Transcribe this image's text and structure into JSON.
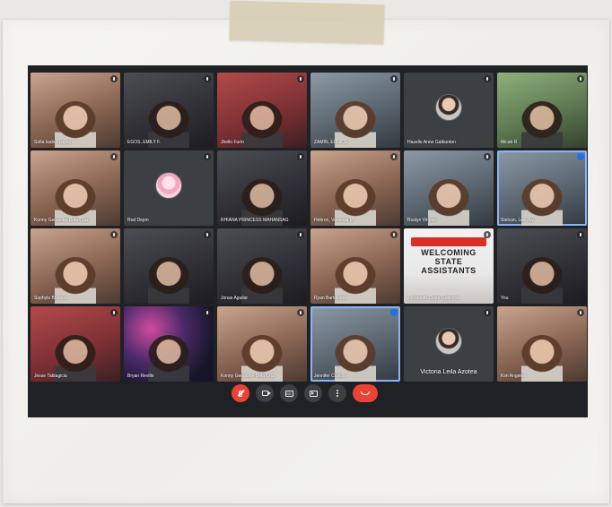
{
  "meeting": {
    "rows": [
      [
        {
          "name": "Sofia Isabel Lopez",
          "type": "video",
          "tone": "warm"
        },
        {
          "name": "EGOS, EMILY F.",
          "type": "video",
          "tone": "dark"
        },
        {
          "name": "Jhello Furio",
          "type": "video",
          "tone": "red"
        },
        {
          "name": "ZAMIN, EUNICE",
          "type": "video",
          "tone": "cool"
        },
        {
          "name": "Hazelle Anne Galbunton",
          "type": "avatar",
          "avatar": "gray"
        },
        {
          "name": "Micah R",
          "type": "video",
          "tone": "green"
        }
      ],
      [
        {
          "name": "Konny Geraldine Dela Cruz",
          "type": "video",
          "tone": "warm"
        },
        {
          "name": "Rod Dejon",
          "type": "avatar",
          "avatar": "pink"
        },
        {
          "name": "RHIANA PRINCESS MAHANSAG",
          "type": "video",
          "tone": "dark"
        },
        {
          "name": "Hebron, Vanessa M.",
          "type": "video",
          "tone": "warm"
        },
        {
          "name": "Roslyn Vingan",
          "type": "video",
          "tone": "cool"
        },
        {
          "name": "Stelcan, Lee Jay",
          "type": "video",
          "tone": "cool",
          "active": true
        }
      ],
      [
        {
          "name": "Sophyla Briones",
          "type": "video",
          "tone": "warm"
        },
        {
          "name": "",
          "type": "video",
          "tone": "dark"
        },
        {
          "name": "Jonas Aguilar",
          "type": "video",
          "tone": "dark"
        },
        {
          "name": "Ryan Bartolome",
          "type": "video",
          "tone": "warm"
        },
        {
          "name": "Johannah Claire Gutierrez",
          "type": "poster",
          "poster_text": "WELCOMING\nSTATE\nASSISTANTS"
        },
        {
          "name": "You",
          "type": "video",
          "tone": "dark"
        }
      ],
      [
        {
          "name": "Jesse Tablagicia",
          "type": "video",
          "tone": "red"
        },
        {
          "name": "Bryan Revillo",
          "type": "video",
          "tone": "fire"
        },
        {
          "name": "Konny Geraldine Dela Cruz",
          "type": "video",
          "tone": "warm"
        },
        {
          "name": "Jennifer Castillo",
          "type": "video",
          "tone": "cool",
          "active": true
        },
        {
          "name": "Victoria Leila Azotea",
          "type": "avatar",
          "avatar": "gray",
          "big_name": true
        },
        {
          "name": "Kim Angeles",
          "type": "video",
          "tone": "warm"
        }
      ]
    ]
  },
  "controls": {
    "mic": "mic-off-icon",
    "camera": "camera-icon",
    "captions": "captions-icon",
    "present": "present-icon",
    "more": "more-icon",
    "hangup": "hangup-icon",
    "captions_text": "CC"
  },
  "colors": {
    "screen_bg": "#202124",
    "tile_bg": "#3c4043",
    "accent": "#8ab4f8",
    "danger": "#ea4335"
  }
}
